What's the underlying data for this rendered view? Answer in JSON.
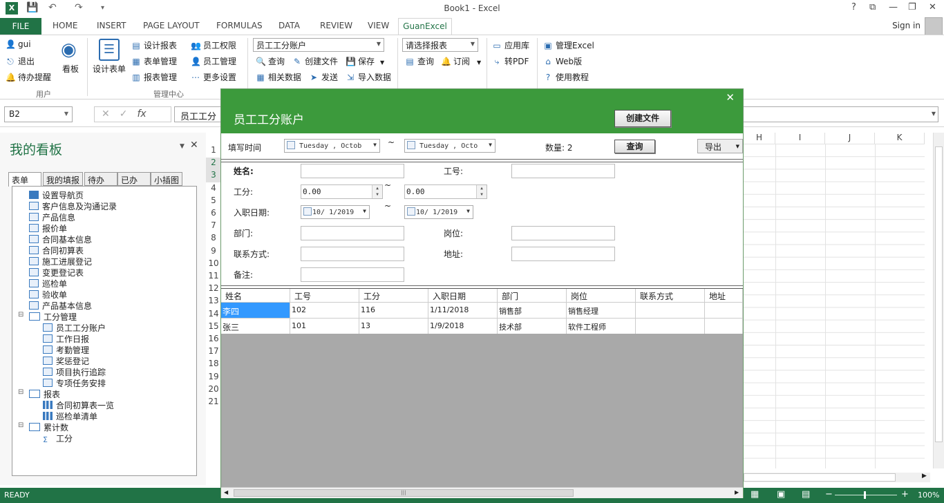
{
  "window": {
    "title": "Book1 - Excel",
    "controls": [
      "?",
      "⧉",
      "—",
      "❐",
      "✕"
    ]
  },
  "quick_access": {
    "save": "💾",
    "undo": "↶",
    "redo": "↷",
    "more": "▾"
  },
  "tabs": [
    "FILE",
    "HOME",
    "INSERT",
    "PAGE LAYOUT",
    "FORMULAS",
    "DATA",
    "REVIEW",
    "VIEW",
    "GuanExcel"
  ],
  "active_tab": "GuanExcel",
  "signin": "Sign in",
  "ribbon": {
    "user": {
      "items": [
        "gui",
        "退出",
        "待办提醒"
      ],
      "feed_label": "看板",
      "group": "用户"
    },
    "mgmt": {
      "design_form": "设计表单",
      "col1": [
        "设计报表",
        "表单管理",
        "报表管理"
      ],
      "col2": [
        "员工权限",
        "员工管理",
        "更多设置"
      ],
      "group": "管理中心"
    },
    "form_select": "员工工分账户",
    "form_actions": [
      "查询",
      "创建文件",
      "保存",
      "相关数据",
      "发送",
      "导入数据"
    ],
    "report_select": "请选择报表",
    "report_actions": [
      "查询",
      "订阅"
    ],
    "tools": [
      "应用库",
      "转PDF"
    ],
    "links": [
      "管理Excel",
      "Web版",
      "使用教程"
    ]
  },
  "formula_bar": {
    "name_box": "B2",
    "fx": "fx",
    "value": "员工工分"
  },
  "panel": {
    "title": "我的看板",
    "tabs": [
      "表单",
      "我的填报",
      "待办",
      "已办",
      "小插图"
    ],
    "tree": [
      {
        "label": "设置导航页",
        "level": 1,
        "type": "nav"
      },
      {
        "label": "客户信息及沟通记录",
        "level": 1,
        "type": "doc"
      },
      {
        "label": "产品信息",
        "level": 1,
        "type": "doc"
      },
      {
        "label": "报价单",
        "level": 1,
        "type": "doc"
      },
      {
        "label": "合同基本信息",
        "level": 1,
        "type": "doc"
      },
      {
        "label": "合同初算表",
        "level": 1,
        "type": "doc"
      },
      {
        "label": "施工进展登记",
        "level": 1,
        "type": "doc"
      },
      {
        "label": "变更登记表",
        "level": 1,
        "type": "doc"
      },
      {
        "label": "巡检单",
        "level": 1,
        "type": "doc"
      },
      {
        "label": "验收单",
        "level": 1,
        "type": "doc"
      },
      {
        "label": "产品基本信息",
        "level": 1,
        "type": "doc"
      },
      {
        "label": "工分管理",
        "level": 1,
        "type": "folder"
      },
      {
        "label": "员工工分账户",
        "level": 2,
        "type": "doc"
      },
      {
        "label": "工作日报",
        "level": 2,
        "type": "doc"
      },
      {
        "label": "考勤管理",
        "level": 2,
        "type": "doc"
      },
      {
        "label": "奖惩登记",
        "level": 2,
        "type": "doc"
      },
      {
        "label": "项目执行追踪",
        "level": 2,
        "type": "doc"
      },
      {
        "label": "专项任务安排",
        "level": 2,
        "type": "doc"
      },
      {
        "label": "报表",
        "level": 1,
        "type": "folder"
      },
      {
        "label": "合同初算表一览",
        "level": 2,
        "type": "chart"
      },
      {
        "label": "巡检单清单",
        "level": 2,
        "type": "chart"
      },
      {
        "label": "累计数",
        "level": 1,
        "type": "folder"
      },
      {
        "label": "工分",
        "level": 2,
        "type": "sum"
      }
    ]
  },
  "sheet": {
    "columns": [
      "H",
      "I",
      "J",
      "K"
    ],
    "rows": [
      "1",
      "2",
      "3",
      "4",
      "5",
      "6",
      "7",
      "8",
      "9",
      "10",
      "11",
      "12",
      "13",
      "14",
      "15",
      "16",
      "17",
      "18",
      "19",
      "20",
      "21"
    ]
  },
  "dialog": {
    "title": "员工工分账户",
    "close": "✕",
    "create_btn": "创建文件",
    "fill_time_label": "填写时间",
    "date_from": "Tuesday ,  Octob",
    "date_to": "Tuesday ,  Octo",
    "tilde": "~",
    "count_label": "数量: 2",
    "query_btn": "查询",
    "export_btn": "导出",
    "fields": {
      "name": "姓名:",
      "empno": "工号:",
      "score": "工分:",
      "score_from": "0.00",
      "score_to": "0.00",
      "hire": "入职日期:",
      "hire_from": "10/ 1/2019",
      "hire_to": "10/ 1/2019",
      "dept": "部门:",
      "post": "岗位:",
      "contact": "联系方式:",
      "addr": "地址:",
      "remark": "备注:"
    },
    "table": {
      "headers": [
        "姓名",
        "工号",
        "工分",
        "入职日期",
        "部门",
        "岗位",
        "联系方式",
        "地址"
      ],
      "rows": [
        [
          "李四",
          "102",
          "116",
          "1/11/2018",
          "销售部",
          "销售经理",
          "",
          ""
        ],
        [
          "张三",
          "101",
          "13",
          "1/9/2018",
          "技术部",
          "软件工程师",
          "",
          ""
        ]
      ]
    },
    "scroll_grip": "|||"
  },
  "status": {
    "ready": "READY",
    "zoom": "100%"
  }
}
